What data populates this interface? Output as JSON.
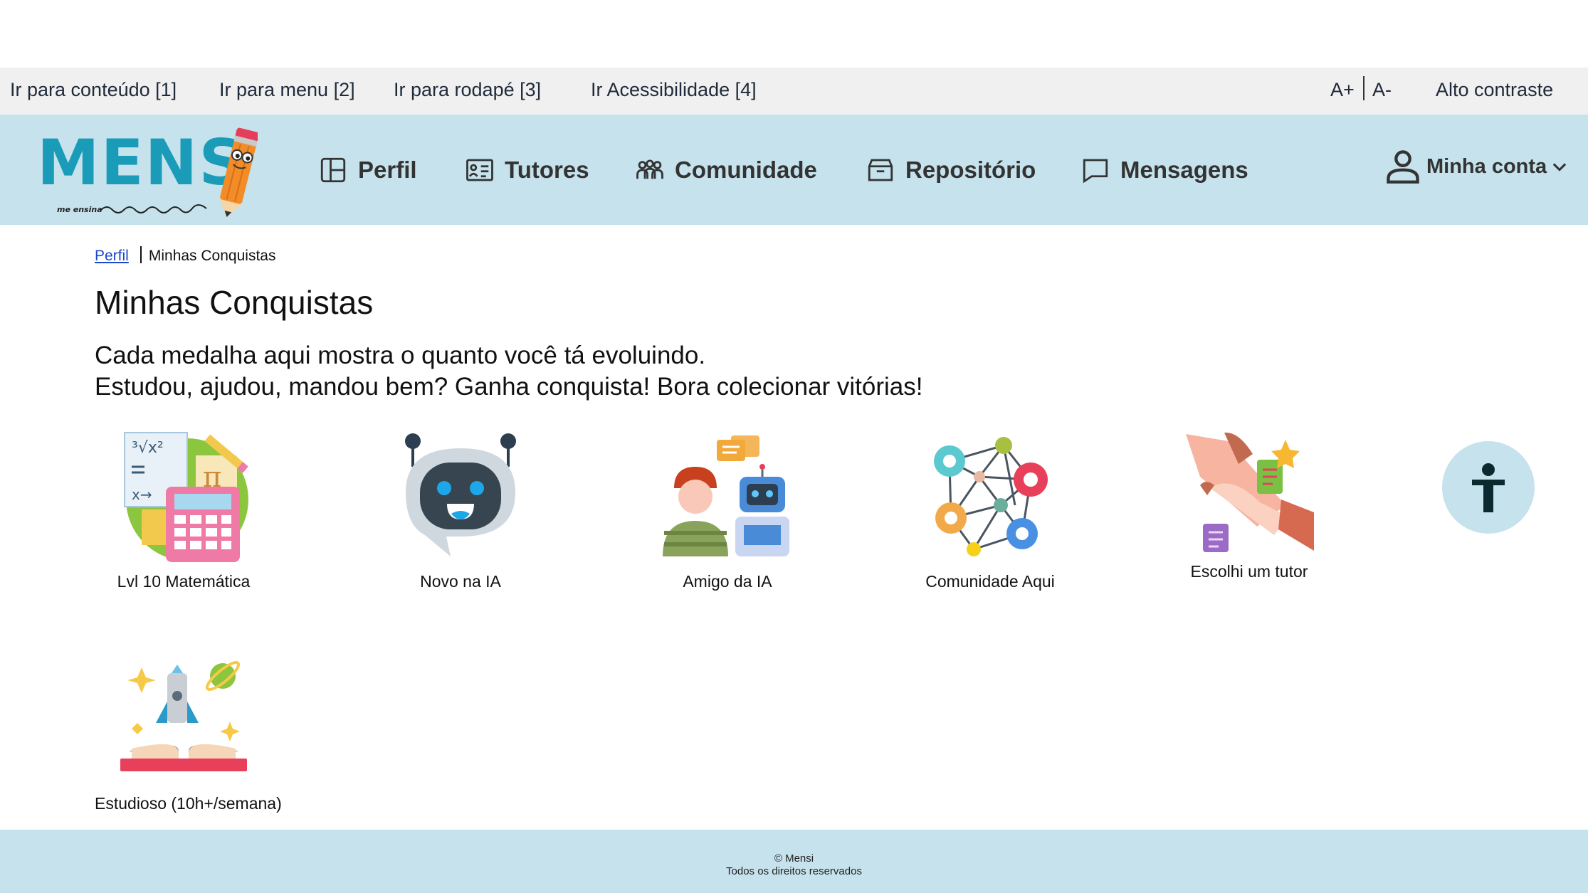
{
  "skip_links": {
    "content": "Ir para conteúdo [1]",
    "menu": "Ir para menu [2]",
    "footer": "Ir para rodapé [3]",
    "accessibility": "Ir Acessibilidade [4]",
    "font_increase": "A+",
    "font_decrease": "A-",
    "high_contrast": "Alto contraste"
  },
  "header": {
    "logo_text": "MENS",
    "logo_tagline": "me ensina",
    "nav": [
      {
        "label": "Perfil",
        "icon": "profile-layout-icon"
      },
      {
        "label": "Tutores",
        "icon": "tutors-list-icon"
      },
      {
        "label": "Comunidade",
        "icon": "community-users-icon"
      },
      {
        "label": "Repositório",
        "icon": "archive-box-icon"
      },
      {
        "label": "Mensagens",
        "icon": "message-bubble-icon"
      }
    ],
    "account_label": "Minha conta"
  },
  "breadcrumb": {
    "parent": "Perfil",
    "current": "Minhas Conquistas"
  },
  "page": {
    "title": "Minhas Conquistas",
    "intro_line1": "Cada medalha aqui mostra o quanto você tá evoluindo.",
    "intro_line2": "Estudou, ajudou, mandou bem? Ganha conquista! Bora colecionar vitórias!"
  },
  "badges": [
    {
      "label": "Lvl 10  Matemática",
      "icon": "math-calculator-icon"
    },
    {
      "label": "Novo na IA",
      "icon": "chatbot-icon"
    },
    {
      "label": "Amigo da IA",
      "icon": "person-and-robot-icon"
    },
    {
      "label": "Comunidade Aqui",
      "icon": "network-community-icon"
    },
    {
      "label": "Escolhi um tutor",
      "icon": "handshake-icon"
    },
    {
      "label": "Estudioso (10h+/semana)",
      "icon": "rocket-book-icon"
    }
  ],
  "footer": {
    "copyright": "© Mensi",
    "rights": "Todos os direitos reservados"
  },
  "colors": {
    "header_bg": "#c6e2ec",
    "skip_bar_bg": "#f0f0f0",
    "logo_teal": "#1a9cb8",
    "link_blue": "#1a48c8"
  }
}
